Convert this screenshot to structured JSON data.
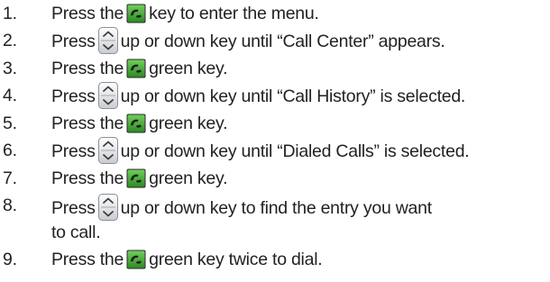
{
  "steps": [
    {
      "num": "1.",
      "before": "Press the",
      "key": "call-key",
      "after": "key to enter the menu."
    },
    {
      "num": "2.",
      "before": "Press",
      "key": "nav-key",
      "after": "up or down key until “Call Center” appears."
    },
    {
      "num": "3.",
      "before": "Press the",
      "key": "call-key",
      "after": "green key."
    },
    {
      "num": "4.",
      "before": "Press",
      "key": "nav-key",
      "after": "up or down key until “Call History” is selected."
    },
    {
      "num": "5.",
      "before": "Press the",
      "key": "call-key",
      "after": "green key."
    },
    {
      "num": "6.",
      "before": "Press",
      "key": "nav-key",
      "after": "up or down key until “Dialed Calls” is selected."
    },
    {
      "num": "7.",
      "before": "Press the",
      "key": "call-key",
      "after": "green key."
    },
    {
      "num": "8.",
      "before": "Press",
      "key": "nav-key",
      "after": "up or down key to find the entry you want",
      "after2": "to call."
    },
    {
      "num": "9.",
      "before": "Press the",
      "key": "call-key",
      "after": "green key twice to dial."
    }
  ],
  "icons": {
    "call-key": {
      "name": "green-call-key-icon",
      "color": "#3a9d2e"
    },
    "nav-key": {
      "name": "up-down-navigation-key-icon",
      "color": "#9aa0a6"
    }
  },
  "colors": {
    "text": "#222222",
    "call_green": "#3a9d2e"
  }
}
